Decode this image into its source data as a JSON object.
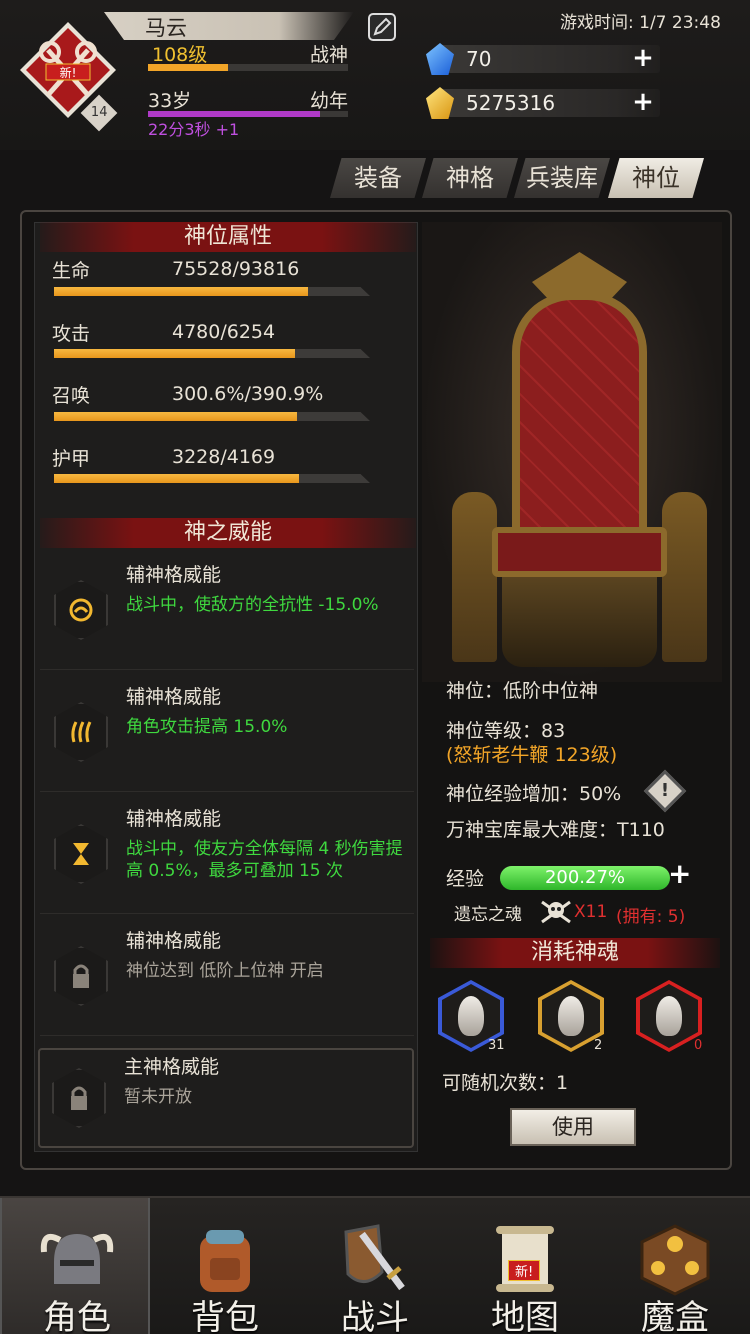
{
  "header": {
    "player_name": "马云",
    "level": "108级",
    "title": "战神",
    "level_progress": 0.4,
    "avatar_badge_level": "14",
    "new_tag": "新!",
    "age": "33岁",
    "stage": "幼年",
    "age_progress": 0.86,
    "age_timer": "22分3秒 +1",
    "game_time": "游戏时间: 1/7 23:48",
    "gems": "70",
    "gold": "5275316"
  },
  "tabs": [
    {
      "label": "装备"
    },
    {
      "label": "神格"
    },
    {
      "label": "兵装库"
    },
    {
      "label": "神位"
    }
  ],
  "attributes": {
    "header": "神位属性",
    "items": [
      {
        "label": "生命",
        "value": "75528/93816",
        "progress": 0.805
      },
      {
        "label": "攻击",
        "value": "4780/6254",
        "progress": 0.764
      },
      {
        "label": "召唤",
        "value": "300.6%/390.9%",
        "progress": 0.769
      },
      {
        "label": "护甲",
        "value": "3228/4169",
        "progress": 0.774
      }
    ]
  },
  "powers": {
    "header": "神之威能",
    "items": [
      {
        "title": "辅神格威能",
        "desc": "战斗中，使敌方的全抗性 -15.0%",
        "state": "active"
      },
      {
        "title": "辅神格威能",
        "desc": "角色攻击提高 15.0%",
        "state": "active"
      },
      {
        "title": "辅神格威能",
        "desc": "战斗中，使友方全体每隔 4 秒伤害提高 0.5%，最多可叠加 15 次",
        "state": "active"
      },
      {
        "title": "辅神格威能",
        "desc": "神位达到 低阶上位神 开启",
        "state": "locked"
      }
    ],
    "main": {
      "title": "主神格威能",
      "desc": "暂未开放",
      "state": "locked"
    }
  },
  "rank_info": {
    "rank": "神位：低阶中位神",
    "rank_level": "神位等级：83",
    "rank_sub": "(怒斩老牛鞭 123级)",
    "exp_bonus": "神位经验增加：50%",
    "max_difficulty": "万神宝库最大难度：T110",
    "exp_label": "经验",
    "exp_value": "200.27%",
    "exp_progress": 1.0,
    "soul_label": "遗忘之魂",
    "soul_count": "X11",
    "soul_owned": "(拥有: 5)"
  },
  "consume": {
    "header": "消耗神魂",
    "slots": [
      {
        "count": "31",
        "color": "#3a5ad8",
        "count_color": "#e8e2d6"
      },
      {
        "count": "2",
        "color": "#d8a030",
        "count_color": "#e8e2d6"
      },
      {
        "count": "0",
        "color": "#d82020",
        "count_color": "#e03030"
      }
    ],
    "random_label": "可随机次数：1",
    "use_label": "使用"
  },
  "nav": [
    {
      "label": "角色",
      "icon": "helmet-icon"
    },
    {
      "label": "背包",
      "icon": "backpack-icon"
    },
    {
      "label": "战斗",
      "icon": "sword-shield-icon"
    },
    {
      "label": "地图",
      "icon": "map-scroll-icon",
      "badge": "新!"
    },
    {
      "label": "魔盒",
      "icon": "magic-box-icon"
    }
  ],
  "colors": {
    "accent_orange": "#f2a528",
    "accent_green": "#3fd83f",
    "header_red": "#7a1212",
    "level_yellow": "#f0c030",
    "age_purple": "#b03ac8"
  }
}
